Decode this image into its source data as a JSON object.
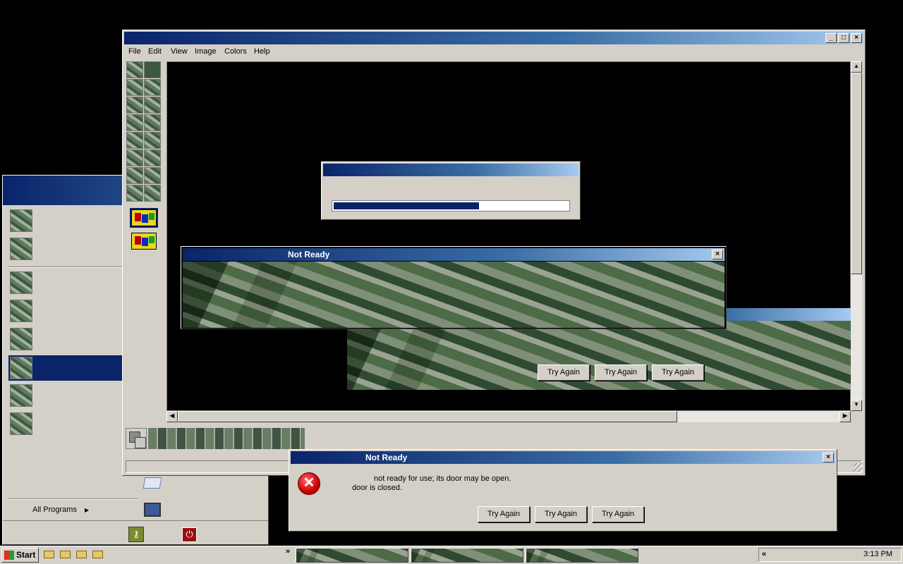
{
  "main_window": {
    "menu": [
      "File",
      "Edit",
      "View",
      "Image",
      "Colors",
      "Help"
    ],
    "controls": {
      "minimize": "_",
      "maximize": "□",
      "close": "×"
    }
  },
  "progress_dialog": {
    "progress_fraction": 0.62
  },
  "not_ready_back": {
    "title": "Not Ready",
    "close": "×",
    "buttons": [
      "Try Again",
      "Try Again",
      "Try Again"
    ]
  },
  "not_ready_front": {
    "title": "Not Ready",
    "close": "×",
    "message_line1": "not ready for use; its door may be open.",
    "message_line2": "door is closed.",
    "icon": "error-icon",
    "buttons": [
      "Try Again",
      "Try Again",
      "Try Again"
    ]
  },
  "start_menu": {
    "all_programs": "All Programs",
    "arrow": "▶"
  },
  "taskbar": {
    "start_label": "Start",
    "chevron": "»",
    "tray_chevron": "«",
    "clock": "3:13 PM"
  },
  "colors": {
    "title_start": "#0a246a",
    "title_end": "#a6caf0",
    "progress": "#0a246a",
    "error_red": "#cc0000"
  }
}
